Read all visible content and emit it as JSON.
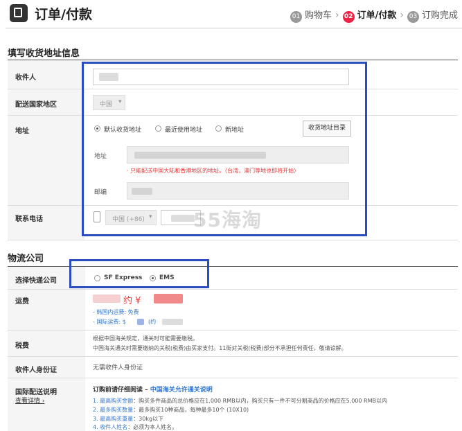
{
  "header": {
    "title": "订单/付款",
    "steps": [
      {
        "num": "01",
        "label": "购物车"
      },
      {
        "num": "02",
        "label": "订单/付款"
      },
      {
        "num": "03",
        "label": "订购完成"
      }
    ]
  },
  "address_section": {
    "title": "填写收货地址信息",
    "recipient_label": "收件人",
    "country_label": "配送国家地区",
    "country_value": "中国",
    "address_label": "地址",
    "address_options": [
      "默认收货地址",
      "最近使用地址",
      "新地址"
    ],
    "address_book_button": "收货地址目录",
    "address_field_label": "地址",
    "address_notice": "· 只能配送中国大陆和香港地区的地址。（台湾，澳门等地也即将开始）",
    "postcode_label": "邮编",
    "phone_label": "联系电话",
    "phone_country": "中国 (+86)"
  },
  "watermark": "55海淘",
  "logistics_section": {
    "title": "物流公司",
    "courier_label": "选择快递公司",
    "couriers": [
      "SF Express",
      "EMS"
    ],
    "selected_courier": "EMS",
    "freight_label": "运费",
    "freight_approx": "约 ¥",
    "korea_freight": "- 韩国内运费: 免费",
    "intl_freight": "- 国际运费: $",
    "intl_freight_approx": "(约",
    "tax_label": "税费",
    "tax_line1": "根据中国海关规定，通关时可能需要缴税。",
    "tax_line2": "中国海关通关时需要缴纳的关税(税费)由买家支付。11街对关税(税费)部分不承担任何责任，敬请谅解。",
    "id_label": "收件人身份证",
    "id_value": "无需收件人身份证",
    "intl_label": "国际配送说明",
    "intl_link": "查看详情 ›",
    "intl_heading": "订购前请仔细阅读 –",
    "intl_heading_link": "中国海关允许通关说明",
    "rules": [
      {
        "key": "1. 最高购买金额",
        "text": "：购买多件商品的总价格应在1,000 RMB以内，购买只有一件不可分割商品的价格应在5,000 RMB以内"
      },
      {
        "key": "2. 最多购买数量",
        "text": "：最多购买10种商品，每种最多10个 (10X10)"
      },
      {
        "key": "3. 最高购买重量",
        "text": "：30kg以下"
      },
      {
        "key": "4. 收件人姓名",
        "text": "：必须为本人姓名。"
      }
    ]
  },
  "colors": {
    "accent": "#e24444",
    "highlight_box": "#2a4dbf",
    "link": "#3377cc"
  }
}
